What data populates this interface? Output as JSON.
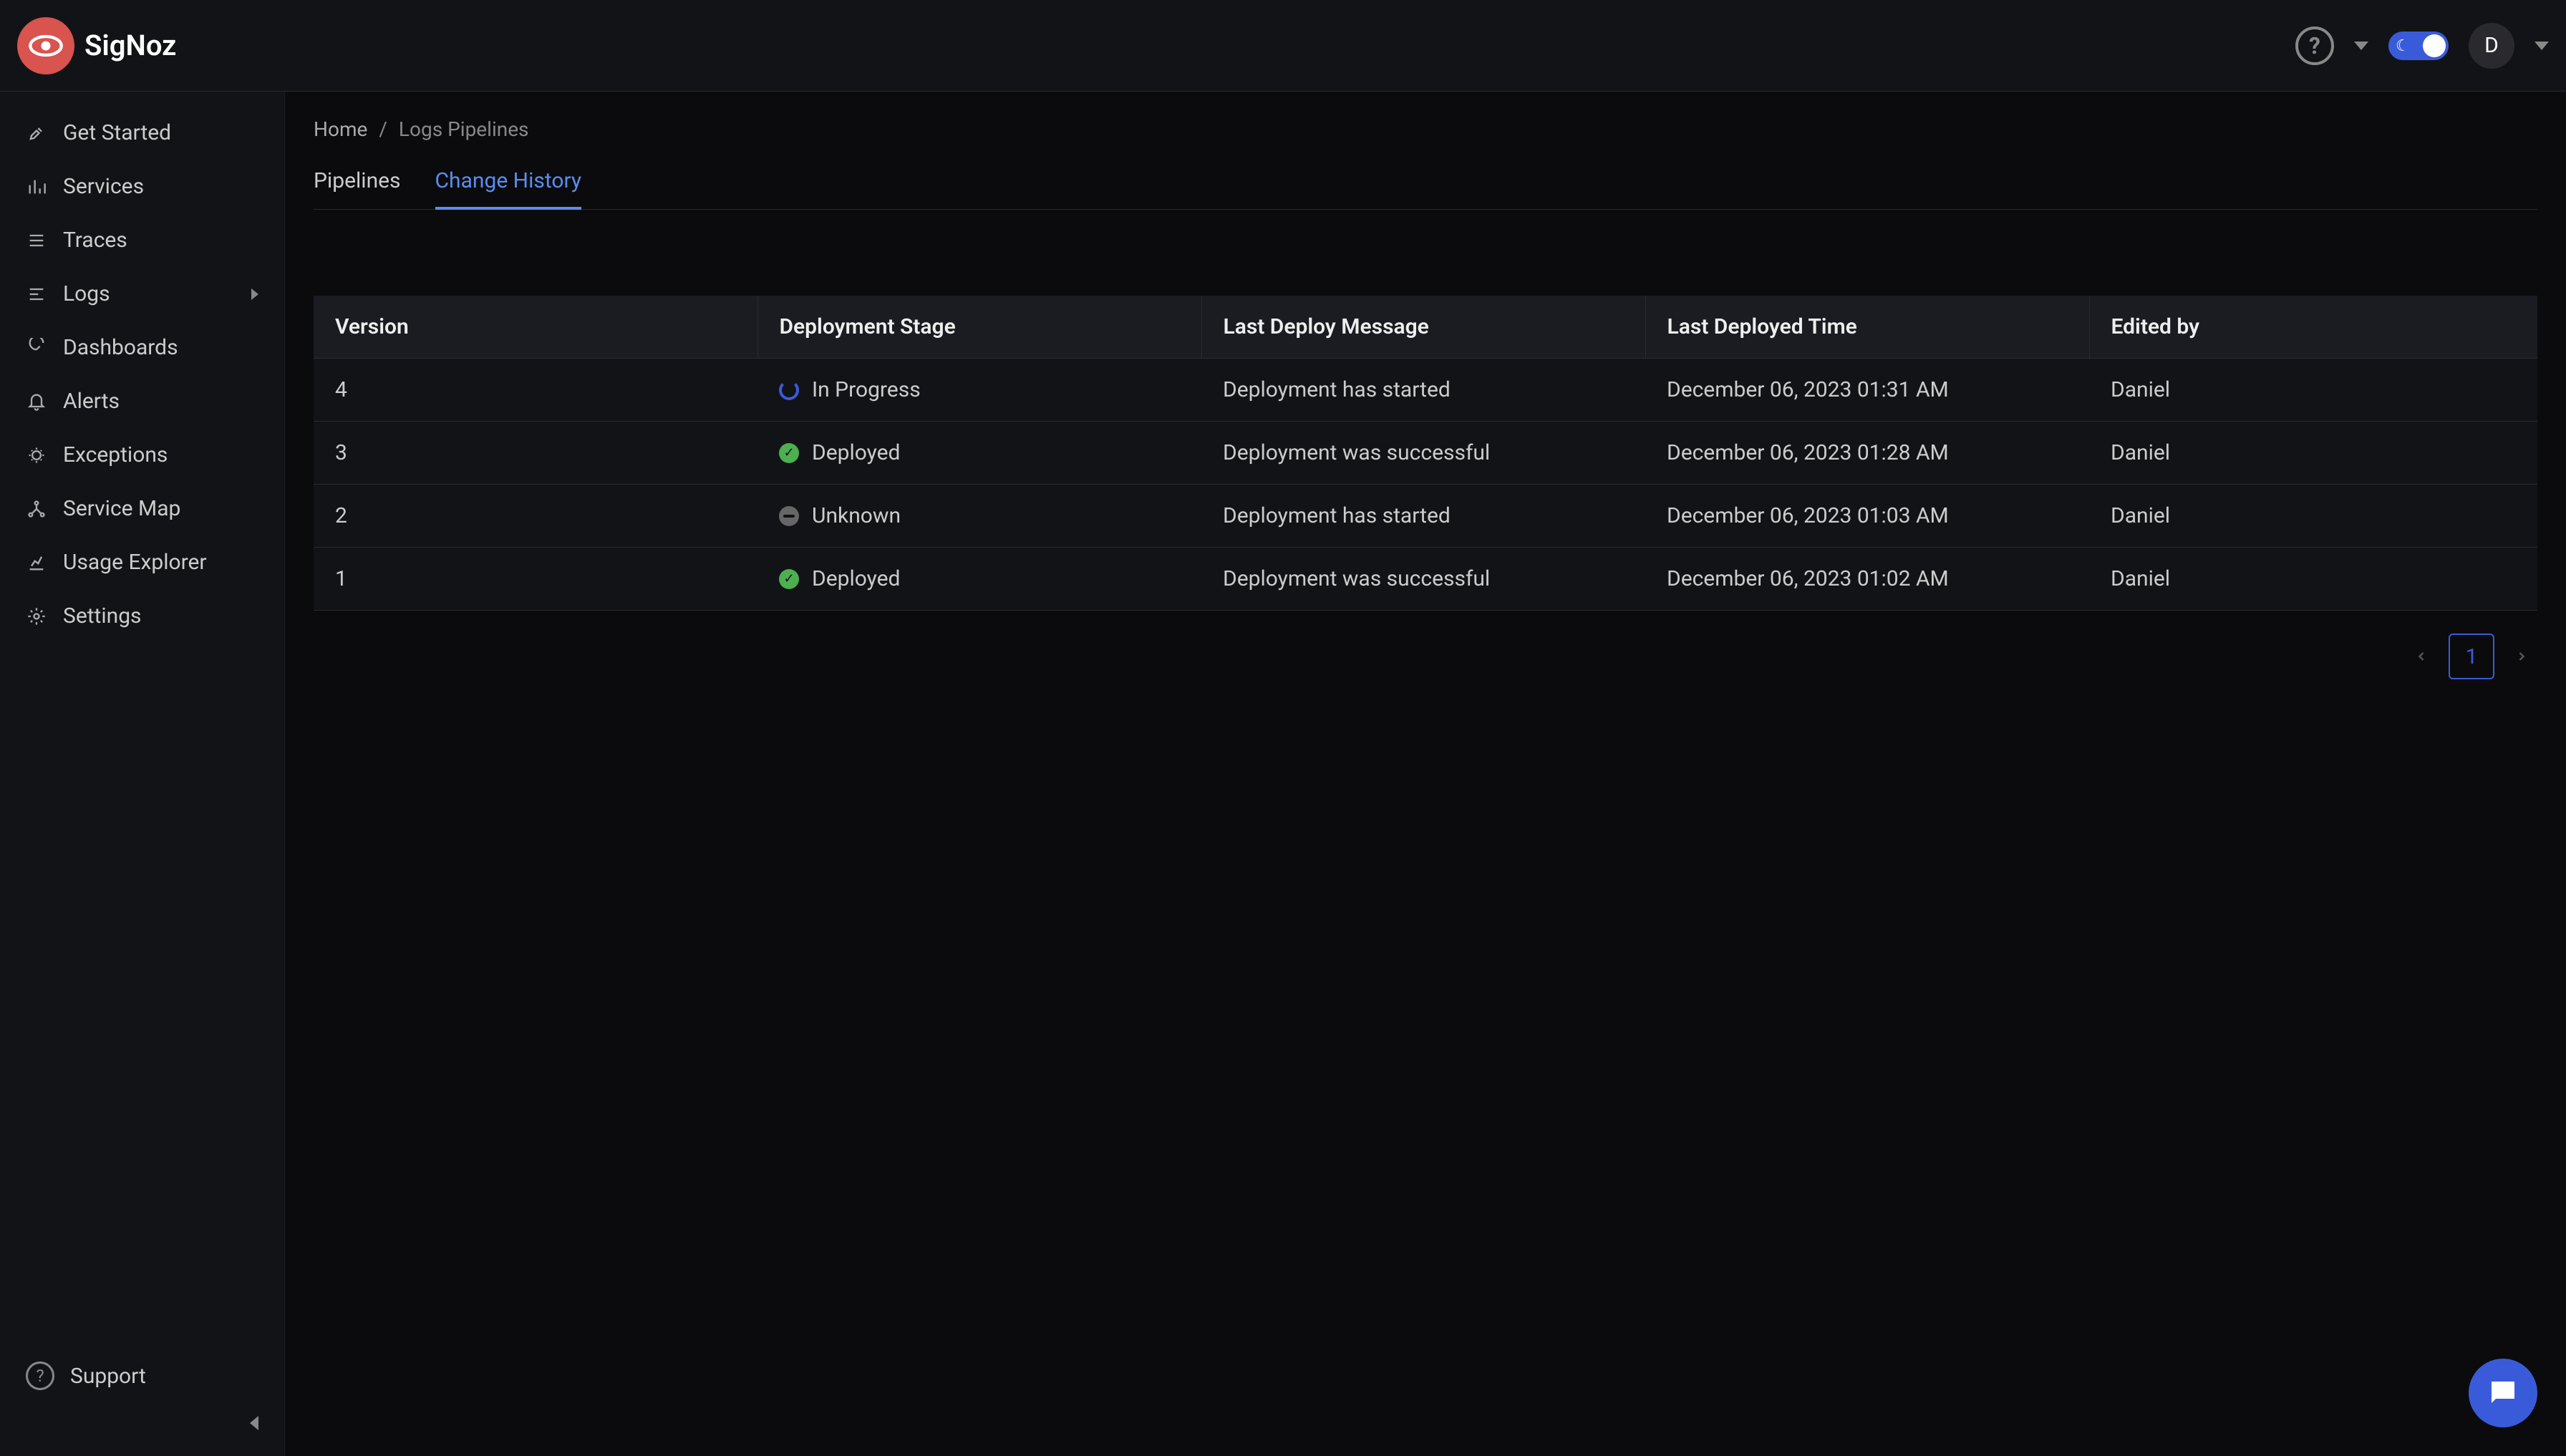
{
  "brand": "SigNoz",
  "topbar": {
    "avatar_initial": "D"
  },
  "sidebar": {
    "items": [
      {
        "label": "Get Started",
        "icon": "rocket-icon",
        "has_children": false
      },
      {
        "label": "Services",
        "icon": "bars-icon",
        "has_children": false
      },
      {
        "label": "Traces",
        "icon": "list-icon",
        "has_children": false
      },
      {
        "label": "Logs",
        "icon": "align-icon",
        "has_children": true
      },
      {
        "label": "Dashboards",
        "icon": "gauge-icon",
        "has_children": false
      },
      {
        "label": "Alerts",
        "icon": "bell-icon",
        "has_children": false
      },
      {
        "label": "Exceptions",
        "icon": "bug-icon",
        "has_children": false
      },
      {
        "label": "Service Map",
        "icon": "network-icon",
        "has_children": false
      },
      {
        "label": "Usage Explorer",
        "icon": "chart-icon",
        "has_children": false
      },
      {
        "label": "Settings",
        "icon": "gear-icon",
        "has_children": false
      }
    ],
    "support_label": "Support"
  },
  "breadcrumb": {
    "home": "Home",
    "current": "Logs Pipelines"
  },
  "tabs": {
    "pipelines": "Pipelines",
    "change_history": "Change History",
    "active": "change_history"
  },
  "table": {
    "headers": {
      "version": "Version",
      "stage": "Deployment Stage",
      "message": "Last Deploy Message",
      "time": "Last Deployed Time",
      "edited_by": "Edited by"
    },
    "rows": [
      {
        "version": "4",
        "stage": "In Progress",
        "status": "progress",
        "message": "Deployment has started",
        "time": "December 06, 2023 01:31 AM",
        "edited_by": "Daniel"
      },
      {
        "version": "3",
        "stage": "Deployed",
        "status": "deployed",
        "message": "Deployment was successful",
        "time": "December 06, 2023 01:28 AM",
        "edited_by": "Daniel"
      },
      {
        "version": "2",
        "stage": "Unknown",
        "status": "unknown",
        "message": "Deployment has started",
        "time": "December 06, 2023 01:03 AM",
        "edited_by": "Daniel"
      },
      {
        "version": "1",
        "stage": "Deployed",
        "status": "deployed",
        "message": "Deployment was successful",
        "time": "December 06, 2023 01:02 AM",
        "edited_by": "Daniel"
      }
    ]
  },
  "pagination": {
    "current": "1"
  }
}
